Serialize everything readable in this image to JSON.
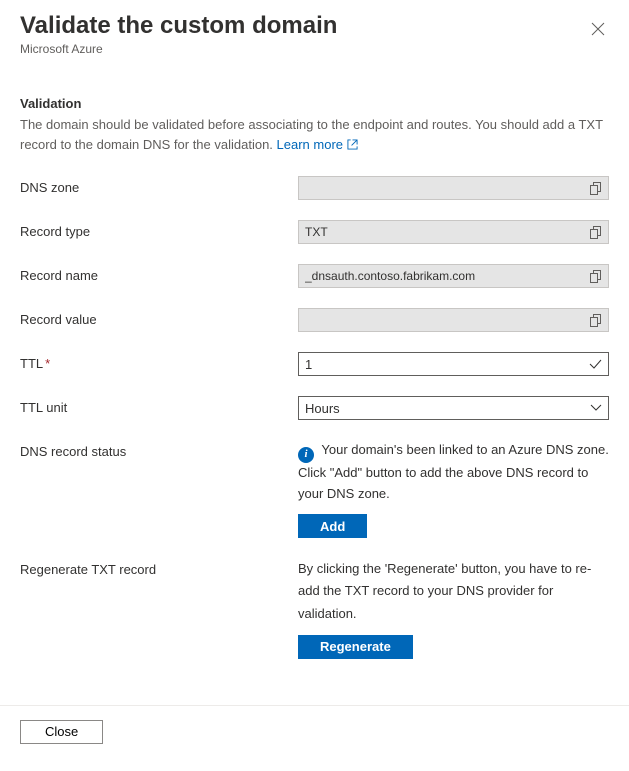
{
  "header": {
    "title": "Validate the custom domain",
    "subtitle": "Microsoft Azure"
  },
  "validation": {
    "heading": "Validation",
    "description": "The domain should be validated before associating to the endpoint and routes. You should add a TXT record to the domain DNS for the validation. ",
    "learn_more": "Learn more"
  },
  "fields": {
    "dns_zone_label": "DNS zone",
    "dns_zone_value": "",
    "record_type_label": "Record type",
    "record_type_value": "TXT",
    "record_name_label": "Record name",
    "record_name_value": "_dnsauth.contoso.fabrikam.com",
    "record_value_label": "Record value",
    "record_value_value": "",
    "ttl_label": "TTL",
    "ttl_value": "1",
    "ttl_unit_label": "TTL unit",
    "ttl_unit_value": "Hours"
  },
  "status": {
    "label": "DNS record status",
    "message": "Your domain's been linked to an Azure DNS zone. Click \"Add\" button to add the above DNS record to your DNS zone.",
    "add_button": "Add"
  },
  "regenerate": {
    "label": "Regenerate TXT record",
    "message": "By clicking the 'Regenerate' button, you have to re-add the TXT record to your DNS provider for validation.",
    "button": "Regenerate"
  },
  "footer": {
    "close": "Close"
  }
}
